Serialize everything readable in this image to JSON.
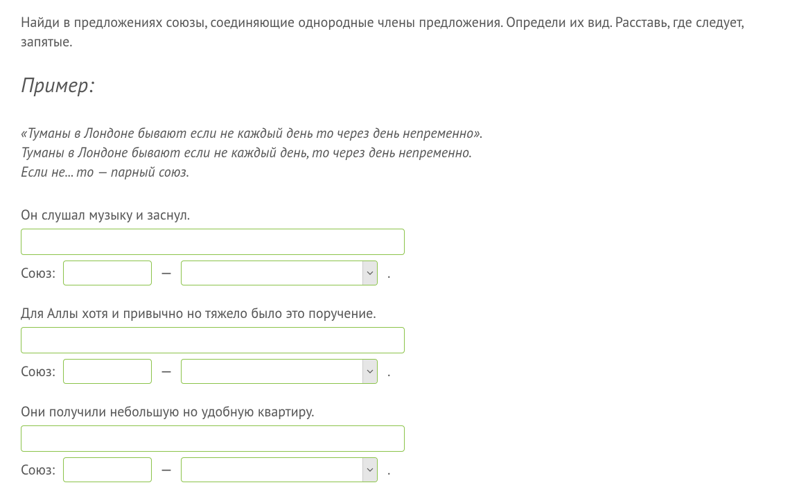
{
  "instruction": "Найди в предложениях союзы, соединяющие однородные члены предложения. Определи их вид. Расставь, где следует, запятые.",
  "example_heading": "Пример:",
  "example": {
    "line1": "«Туманы в Лондоне бывают если не каждый день то через день непременно».",
    "line2": "Туманы в Лондоне бывают если не каждый день, то через день непременно.",
    "line3": "Если не... то — парный союз."
  },
  "labels": {
    "conj": "Союз:",
    "dash": "—",
    "period": "."
  },
  "exercises": [
    {
      "sentence": "Он слушал музыку и заснул.",
      "answer": "",
      "conj_value": "",
      "type_value": ""
    },
    {
      "sentence": "Для Аллы хотя и привычно но тяжело было это поручение.",
      "answer": "",
      "conj_value": "",
      "type_value": ""
    },
    {
      "sentence": "Они получили небольшую но удобную квартиру.",
      "answer": "",
      "conj_value": "",
      "type_value": ""
    }
  ]
}
